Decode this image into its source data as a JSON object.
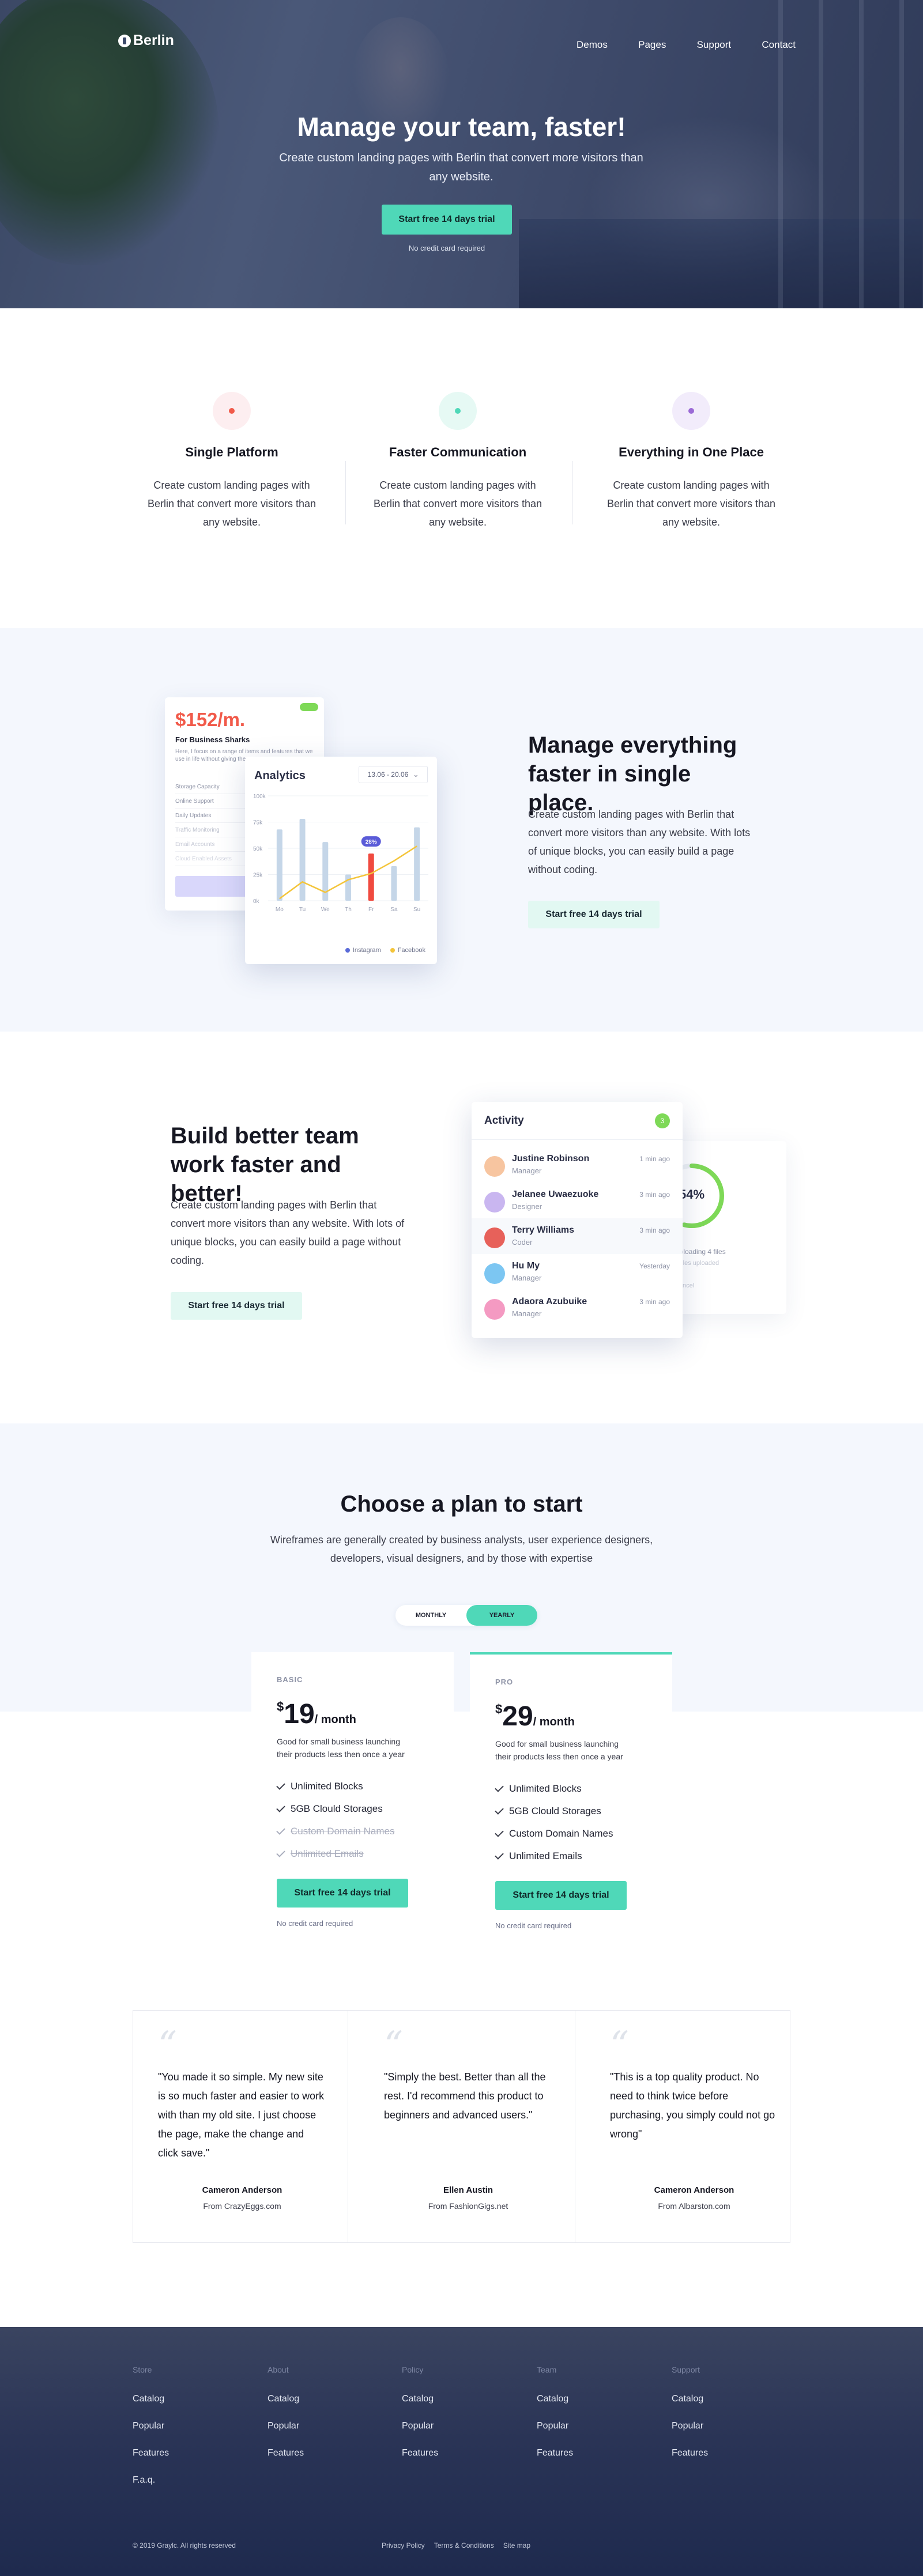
{
  "header": {
    "logo": "Berlin",
    "nav": [
      "Demos",
      "Pages",
      "Support",
      "Contact"
    ]
  },
  "hero": {
    "title": "Manage your team, faster!",
    "subtitle": "Create custom landing pages with Berlin that convert more visitors than any website.",
    "cta": "Start free 14 days trial",
    "note": "No credit card required"
  },
  "features": [
    {
      "title": "Single Platform",
      "text": "Create custom landing pages with Berlin that convert more visitors than any website.",
      "color": "#f15a4a",
      "tint": "#fdeef0"
    },
    {
      "title": "Faster Communication",
      "text": "Create custom landing pages with Berlin that convert more visitors than any website.",
      "color": "#4fd8b8",
      "tint": "#e6f9f4"
    },
    {
      "title": "Everything in One Place",
      "text": "Create custom landing pages with Berlin that convert more visitors than any website.",
      "color": "#9b6ad6",
      "tint": "#f2ecfb"
    }
  ],
  "manage": {
    "title": "Manage everything faster in single place.",
    "text": "Create custom landing pages with Berlin that convert more visitors than any website. With lots of unique blocks, you can easily build a page without coding.",
    "cta": "Start free 14 days trial",
    "price_card": {
      "price": "$152/m.",
      "subtitle": "For Business Sharks",
      "desc": "Here, I focus on a range of items and features that we use in life without giving them",
      "rows": [
        "Storage Capacity",
        "Online Support",
        "Daily Updates",
        "Traffic Monitoring",
        "Email Accounts",
        "Cloud Enabled Assets"
      ]
    },
    "analytics": {
      "title": "Analytics",
      "range": "13.06 - 20.06",
      "legend": [
        "Instagram",
        "Facebook"
      ],
      "badge": "28%"
    }
  },
  "chart_data": {
    "type": "bar",
    "categories": [
      "Mo",
      "Tu",
      "We",
      "Th",
      "Fr",
      "Sa",
      "Su"
    ],
    "ylabels": [
      "0k",
      "25k",
      "50k",
      "75k",
      "100k"
    ],
    "ylim": [
      0,
      100
    ],
    "series": [
      {
        "name": "Instagram",
        "values": [
          68,
          78,
          56,
          25,
          45,
          33,
          70
        ],
        "highlight_index": 4,
        "color": "#c5d6e8",
        "highlight_color": "#f04a3f"
      },
      {
        "name": "Facebook",
        "values": [
          2,
          18,
          8,
          20,
          26,
          38,
          52
        ],
        "color": "#f4c53b",
        "type": "line"
      }
    ]
  },
  "team": {
    "title": "Build better team work faster and better!",
    "text": "Create custom landing pages with Berlin that convert more visitors than any website. With lots of unique blocks, you can easily build a page without coding.",
    "cta": "Start free 14 days trial",
    "activity": {
      "title": "Activity",
      "count": "3",
      "items": [
        {
          "name": "Justine Robinson",
          "role": "Manager",
          "time": "1 min ago",
          "color": "#f7c5a0"
        },
        {
          "name": "Jelanee Uwaezuoke",
          "role": "Designer",
          "time": "3 min ago",
          "color": "#c9b6f0"
        },
        {
          "name": "Terry Williams",
          "role": "Coder",
          "time": "3 min ago",
          "color": "#e7615a"
        },
        {
          "name": "Hu My",
          "role": "Manager",
          "time": "Yesterday",
          "color": "#7cc6f2"
        },
        {
          "name": "Adaora Azubuike",
          "role": "Manager",
          "time": "3 min ago",
          "color": "#f49ac2"
        }
      ]
    },
    "ring": {
      "percent": "54%",
      "value": 0.54,
      "line1": "Uploading 4 files",
      "line2": "3 files uploaded",
      "cancel": "Cancel"
    }
  },
  "pricing": {
    "title": "Choose a plan to start",
    "subtitle": "Wireframes are generally created by business analysts, user experience designers, developers, visual designers, and by those with expertise",
    "toggle": [
      "MONTHLY",
      "YEARLY"
    ],
    "plans": [
      {
        "name": "BASIC",
        "currency": "$",
        "amount": "19",
        "period": "/ month",
        "desc": "Good for small business launching their products less then once a year",
        "features": [
          {
            "t": "Unlimited Blocks",
            "on": true
          },
          {
            "t": "5GB Clould Storages",
            "on": true
          },
          {
            "t": "Custom Domain Names",
            "on": false
          },
          {
            "t": "Unlimited Emails",
            "on": false
          }
        ],
        "cta": "Start free 14 days trial",
        "note": "No credit card required"
      },
      {
        "name": "PRO",
        "currency": "$",
        "amount": "29",
        "period": "/ month",
        "desc": "Good for small business launching their products less then once a year",
        "features": [
          {
            "t": "Unlimited Blocks",
            "on": true
          },
          {
            "t": "5GB Clould Storages",
            "on": true
          },
          {
            "t": "Custom Domain Names",
            "on": true
          },
          {
            "t": "Unlimited Emails",
            "on": true
          }
        ],
        "cta": "Start free 14 days trial",
        "note": "No credit card required"
      }
    ]
  },
  "testimonials": [
    {
      "quote": "\"You made it so simple. My new site is so much faster and easier to work with than my old site. I just choose the page, make the change and click save.\"",
      "author": "Cameron Anderson",
      "from": "From CrazyEggs.com"
    },
    {
      "quote": "\"Simply the best. Better than all the rest. I'd recommend this product to beginners and advanced users.\"",
      "author": "Ellen Austin",
      "from": "From FashionGigs.net"
    },
    {
      "quote": "\"This is a top quality product. No need to think twice before purchasing, you simply could not go wrong\"",
      "author": "Cameron Anderson",
      "from": "From Albarston.com"
    }
  ],
  "footer": {
    "columns": [
      {
        "title": "Store",
        "items": [
          "Catalog",
          "Popular",
          "Features",
          "F.a.q."
        ]
      },
      {
        "title": "About",
        "items": [
          "Catalog",
          "Popular",
          "Features"
        ]
      },
      {
        "title": "Policy",
        "items": [
          "Catalog",
          "Popular",
          "Features"
        ]
      },
      {
        "title": "Team",
        "items": [
          "Catalog",
          "Popular",
          "Features"
        ]
      },
      {
        "title": "Support",
        "items": [
          "Catalog",
          "Popular",
          "Features"
        ]
      }
    ],
    "copyright": "© 2019 Graylc. All rights reserved",
    "links": [
      "Privacy Policy",
      "Terms & Conditions",
      "Site map"
    ]
  },
  "colors": {
    "accent": "#4fd8b8",
    "dark_navy": "#1e2a4e",
    "soft_bg": "#f4f7fd"
  }
}
